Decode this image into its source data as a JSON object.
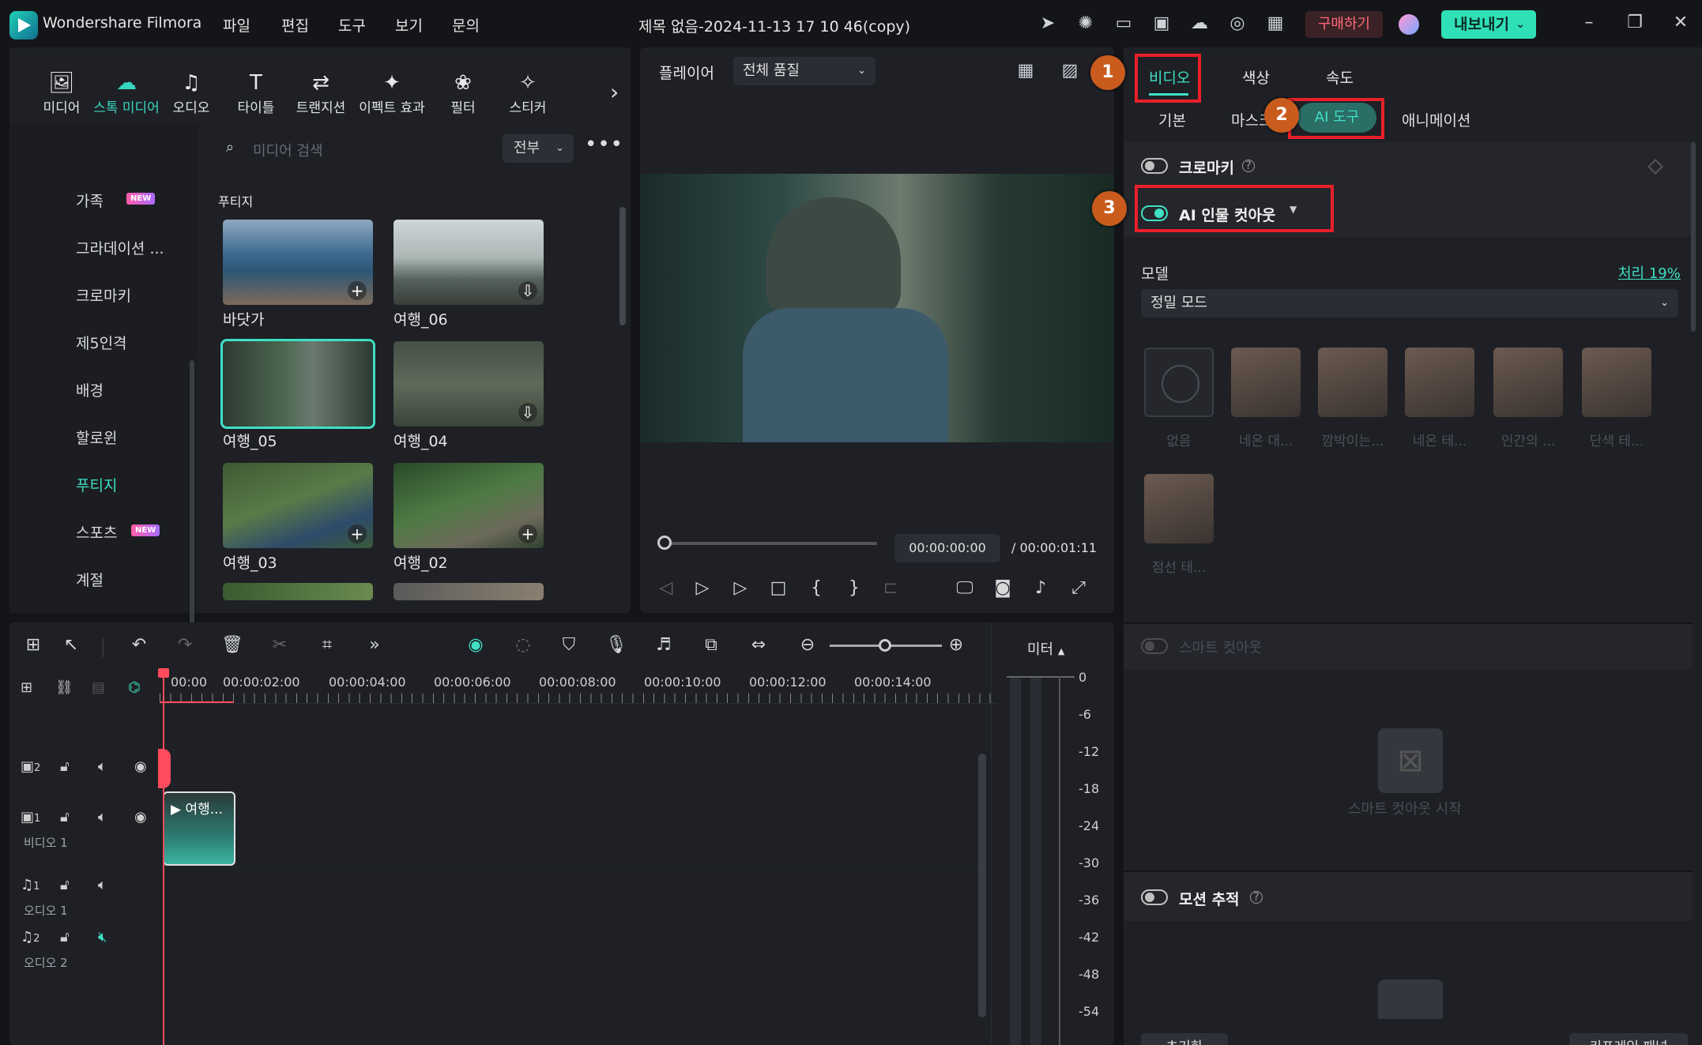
{
  "app": {
    "name": "Wondershare Filmora",
    "doc_title": "제목 없음-2024-11-13 17 10 46(copy)"
  },
  "menu": [
    "파일",
    "편집",
    "도구",
    "보기",
    "문의"
  ],
  "titlebar": {
    "buy_label": "구매하기",
    "export_label": "내보내기"
  },
  "toolbar": {
    "items": [
      {
        "label": "미디어",
        "icon": "media-icon"
      },
      {
        "label": "스톡 미디어",
        "icon": "stock-media-icon"
      },
      {
        "label": "오디오",
        "icon": "audio-icon"
      },
      {
        "label": "타이틀",
        "icon": "title-icon"
      },
      {
        "label": "트랜지션",
        "icon": "transition-icon"
      },
      {
        "label": "이펙트 효과",
        "icon": "effects-icon"
      },
      {
        "label": "필터",
        "icon": "filter-icon"
      },
      {
        "label": "스티커",
        "icon": "sticker-icon"
      }
    ],
    "active_index": 1
  },
  "categories": {
    "items": [
      "가족",
      "그라데이션 ...",
      "크로마키",
      "제5인격",
      "배경",
      "할로윈",
      "푸티지",
      "스포츠",
      "계절"
    ],
    "new_badge": "NEW",
    "active": "푸티지"
  },
  "media": {
    "search_placeholder": "미디어 검색",
    "filter": "전부",
    "section": "푸티지",
    "items": [
      "바닷가",
      "여행_06",
      "여행_05",
      "여행_04",
      "여행_03",
      "여행_02"
    ]
  },
  "player": {
    "label": "플레이어",
    "quality": "전체 품질",
    "current_time": "00:00:00:00",
    "total_time": "/ 00:00:01:11"
  },
  "inspector": {
    "tabs": [
      "비디오",
      "색상",
      "속도"
    ],
    "subtabs": [
      "기본",
      "마스크",
      "AI 도구",
      "애니메이션"
    ],
    "chroma_key": "크로마키",
    "ai_cutout": "AI 인물 컷아웃",
    "model_label": "모델",
    "progress": "처리 19%",
    "model_value": "정밀 모드",
    "presets": [
      "없음",
      "네온 대...",
      "깜박이는...",
      "네온 테...",
      "인간의 ...",
      "단색 테...",
      "점선 테..."
    ],
    "smart_cutout": "스마트 컷아웃",
    "smart_cutout_start": "스마트 컷아웃 시작",
    "motion_tracking": "모션 추적",
    "reset": "초기화",
    "keyframe_panel": "키프레임 패널",
    "callouts": [
      "1",
      "2",
      "3"
    ]
  },
  "timeline": {
    "meter_label": "미터",
    "ticks": [
      "00:00",
      "00:00:02:00",
      "00:00:04:00",
      "00:00:06:00",
      "00:00:08:00",
      "00:00:10:00",
      "00:00:12:00",
      "00:00:14:00"
    ],
    "tracks": [
      {
        "num": "2",
        "name": ""
      },
      {
        "num": "1",
        "name": "비디오 1"
      },
      {
        "num": "1",
        "name": "오디오 1"
      },
      {
        "num": "2",
        "name": "오디오 2"
      }
    ],
    "clip_label": "여행...",
    "db_scale": [
      "0",
      "-6",
      "-12",
      "-18",
      "-24",
      "-30",
      "-36",
      "-42",
      "-48",
      "-54"
    ]
  },
  "colors": {
    "accent": "#3fe0c4",
    "highlight": "#e8202a",
    "callout": "#c95b1c"
  }
}
